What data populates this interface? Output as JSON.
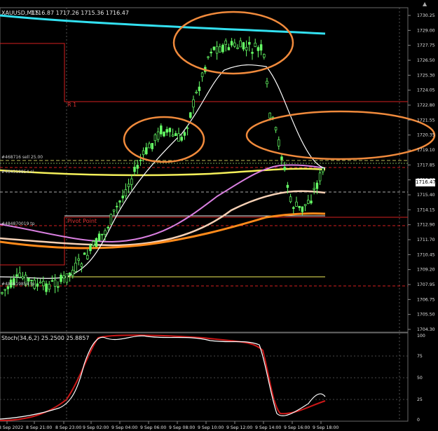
{
  "window": {
    "symbol_title": "XAUUSD,M15",
    "ohlc_text": "1716.87 1717.26 1715.36 1716.47",
    "collapse_icon": "chevron-up-icon"
  },
  "price_axis": {
    "labels": [
      "1730.25",
      "1729.00",
      "1727.75",
      "1726.50",
      "1725.30",
      "1724.05",
      "1722.80",
      "1721.55",
      "1720.35",
      "1719.10",
      "1717.85",
      "1716.60",
      "1715.40",
      "1714.15",
      "1712.90",
      "1711.70",
      "1710.45",
      "1709.20",
      "1707.95",
      "1706.75",
      "1705.50",
      "1704.30"
    ],
    "current_price": "1716.47"
  },
  "time_axis": {
    "labels": [
      "8 Sep 2022",
      "8 Sep 21:00",
      "8 Sep 23:00",
      "9 Sep 02:00",
      "9 Sep 04:00",
      "9 Sep 06:00",
      "9 Sep 08:00",
      "9 Sep 10:00",
      "9 Sep 12:00",
      "9 Sep 14:00",
      "9 Sep 16:00",
      "9 Sep 18:00"
    ]
  },
  "chart_labels": {
    "r1": "R 1",
    "pivot_point": "Pivot Point",
    "sell_tag": "#468716 sell 25.00",
    "tag_a": "#484319854 sl",
    "tag_b": "#484870019 tp",
    "tag_c": "#484619854 tp"
  },
  "stochastic": {
    "title": "Stoch(34,6,2) 25.2500 25.8857",
    "axis_labels": [
      "100",
      "75",
      "50",
      "25",
      "0"
    ]
  },
  "colors": {
    "background": "#000000",
    "candle": "#66ff66",
    "cyan_ma": "#33e0f0",
    "yellow_ma": "#f5f05a",
    "violet_ma": "#d97fe0",
    "white_ma": "#ffffff",
    "peach_ma": "#f5d0b5",
    "orange_ma": "#ff8a1a",
    "ellipse": "#f08a3c",
    "red_level": "#d42020",
    "stoch_main": "#ffffff",
    "stoch_signal": "#cc1818"
  },
  "chart_data": {
    "type": "candlestick",
    "symbol": "XAUUSD",
    "timeframe": "M15",
    "ylim": [
      1704.3,
      1730.25
    ],
    "x": [
      "8 Sep 2022",
      "8 Sep 21:00",
      "8 Sep 23:00",
      "9 Sep 02:00",
      "9 Sep 04:00",
      "9 Sep 06:00",
      "9 Sep 08:00",
      "9 Sep 10:00",
      "9 Sep 12:00",
      "9 Sep 14:00",
      "9 Sep 16:00",
      "9 Sep 18:00"
    ],
    "levels": {
      "R 1": 1722.8,
      "Pivot Point": 1713.5
    },
    "stochastic": {
      "main": 25.25,
      "signal": 25.8857
    }
  }
}
